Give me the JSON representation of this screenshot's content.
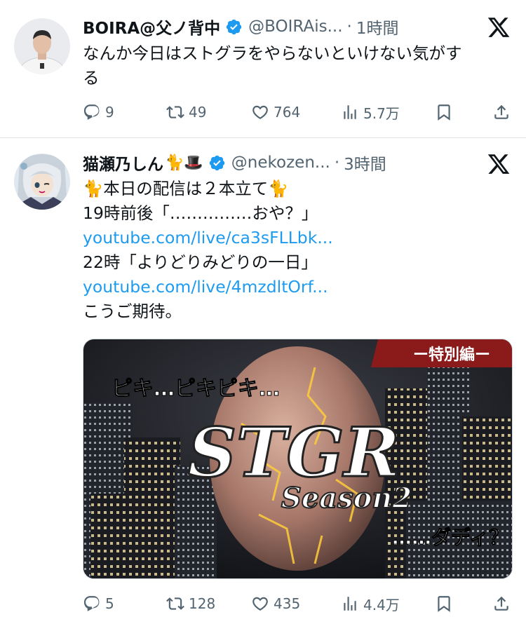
{
  "tweets": [
    {
      "display_name": "BOIRA@父ノ背中",
      "handle": "@BOIRAis...",
      "separator": "·",
      "time": "1時間",
      "text_lines": [
        "なんか今日はストグラをやらないといけない気がす",
        "る"
      ],
      "actions": {
        "replies": "9",
        "reposts": "49",
        "likes": "764",
        "views": "5.7万"
      }
    },
    {
      "display_name": "猫瀬乃しん",
      "name_emoji": "🐈🎩",
      "handle": "@nekozen...",
      "separator": "·",
      "time": "3時間",
      "text_lines": [
        "🐈本日の配信は２本立て🐈",
        "19時前後「……………おや？」",
        "youtube.com/live/ca3sFLLbk...",
        "22時「よりどりみどりの一日」",
        "youtube.com/live/4mzdltOrf...",
        "こうご期待。"
      ],
      "media": {
        "banner": "ー特別編ー",
        "top_text": "ピキ…ピキピキ…",
        "logo_main": "STGR",
        "logo_sub": "Season2",
        "bottom_text": "……ダディ？"
      },
      "actions": {
        "replies": "5",
        "reposts": "128",
        "likes": "435",
        "views": "4.4万"
      }
    }
  ],
  "icons": [
    "verified-badge-icon",
    "x-logo-icon",
    "reply-icon",
    "repost-icon",
    "like-icon",
    "views-icon",
    "bookmark-icon",
    "share-icon"
  ],
  "colors": {
    "link": "#1d9bf0",
    "verified": "#1d9bf0",
    "muted": "#536471",
    "divider": "#dfe3e6",
    "banner": "#8b1a1a"
  }
}
